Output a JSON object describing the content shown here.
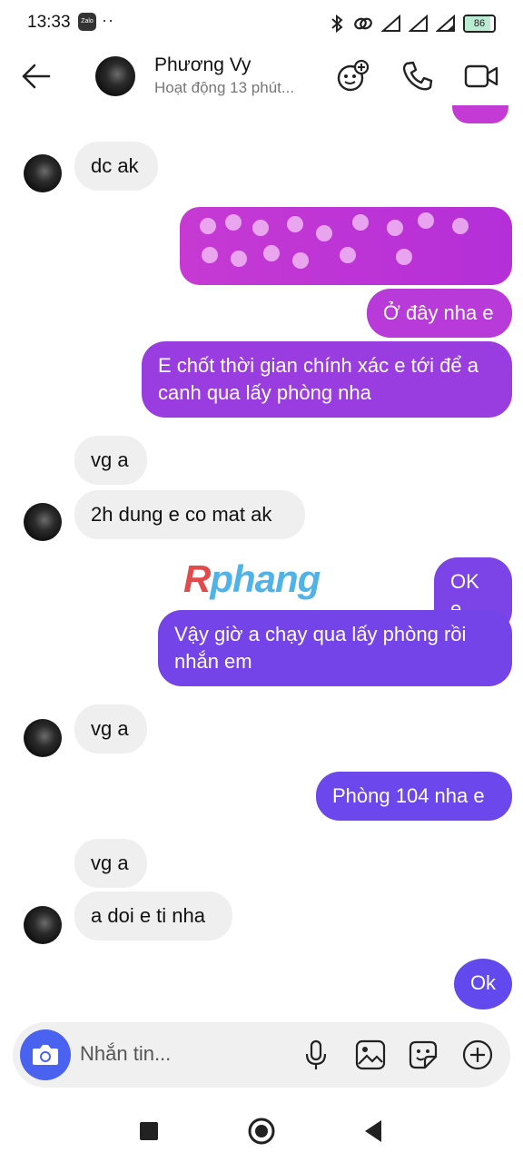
{
  "status_bar": {
    "time": "13:33",
    "zalo_label": "Zalo",
    "more": "··",
    "battery": "86",
    "battery_level_percent": 86
  },
  "header": {
    "contact_name": "Phương Vy",
    "contact_status": "Hoạt động 13 phút...",
    "icons": [
      "back-arrow-icon",
      "add-member-icon",
      "phone-icon",
      "video-icon"
    ]
  },
  "messages": [
    {
      "side": "received",
      "text": "dc ak"
    },
    {
      "side": "sent",
      "text": "",
      "redacted": true
    },
    {
      "side": "sent",
      "text": "Ở đây nha e"
    },
    {
      "side": "sent",
      "text": "E chốt thời gian chính xác e tới để a canh qua lấy phòng nha"
    },
    {
      "side": "received",
      "text": "vg a"
    },
    {
      "side": "received",
      "text": "2h dung e co mat ak"
    },
    {
      "side": "sent",
      "text": "OK e"
    },
    {
      "side": "sent",
      "text": "Vậy giờ a chạy qua lấy phòng rồi nhắn em"
    },
    {
      "side": "received",
      "text": "vg a"
    },
    {
      "side": "sent",
      "text": "Phòng 104 nha e"
    },
    {
      "side": "received",
      "text": "vg a"
    },
    {
      "side": "received",
      "text": "a doi e ti nha"
    },
    {
      "side": "sent",
      "text": "Ok"
    }
  ],
  "watermark": {
    "r": "R",
    "rest": "phang"
  },
  "composer": {
    "placeholder": "Nhắn tin...",
    "icons": [
      "camera-icon",
      "microphone-icon",
      "image-icon",
      "sticker-icon",
      "plus-circle-icon"
    ]
  },
  "colors": {
    "sent_pink": "#c43ad4",
    "sent_purple": "#8a3fe0",
    "sent_violet": "#6b47ec",
    "received": "#efefef",
    "camera_button": "#4a62f0"
  },
  "nav": {
    "icons": [
      "recent-apps-icon",
      "home-icon",
      "back-icon"
    ]
  }
}
